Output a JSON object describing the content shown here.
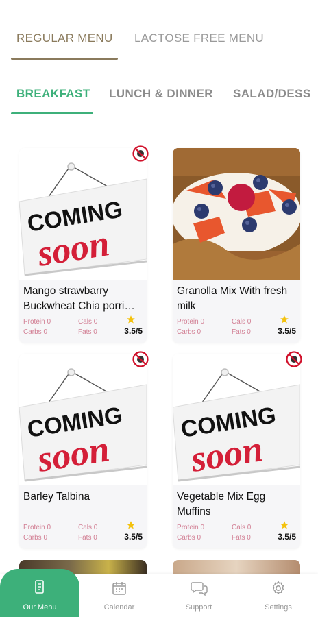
{
  "menu_tabs": [
    "REGULAR MENU",
    "LACTOSE FREE MENU"
  ],
  "category_tabs": [
    "BREAKFAST",
    "LUNCH & DINNER",
    "SALAD/DESS"
  ],
  "colors": {
    "accent_green": "#3db07a",
    "accent_brown": "#8a7a5c",
    "nutrition_pink": "#d27f94",
    "star": "#f4c20d"
  },
  "coming_soon": {
    "line1": "COMING",
    "line2": "SOON"
  },
  "meals": [
    {
      "title": "Mango strawbarry Buckwheat Chia porri…",
      "protein": "Protein 0",
      "carbs": "Carbs 0",
      "cals": "Cals 0",
      "fats": "Fats 0",
      "rating": "3.5/5",
      "image": "coming-soon"
    },
    {
      "title": "Granolla Mix With fresh milk",
      "protein": "Protein 0",
      "carbs": "Carbs 0",
      "cals": "Cals 0",
      "fats": "Fats 0",
      "rating": "3.5/5",
      "image": "granola-photo"
    },
    {
      "title": "Barley Talbina",
      "protein": "Protein 0",
      "carbs": "Carbs 0",
      "cals": "Cals 0",
      "fats": "Fats 0",
      "rating": "3.5/5",
      "image": "coming-soon"
    },
    {
      "title": "Vegetable Mix Egg Muffins",
      "protein": "Protein 0",
      "carbs": "Carbs 0",
      "cals": "Cals 0",
      "fats": "Fats 0",
      "rating": "3.5/5",
      "image": "coming-soon"
    }
  ],
  "bottom_nav": [
    {
      "label": "Our Menu",
      "icon": "menu-book-icon",
      "active": true
    },
    {
      "label": "Calendar",
      "icon": "calendar-icon",
      "active": false
    },
    {
      "label": "Support",
      "icon": "chat-support-icon",
      "active": false
    },
    {
      "label": "Settings",
      "icon": "gear-icon",
      "active": false
    }
  ]
}
